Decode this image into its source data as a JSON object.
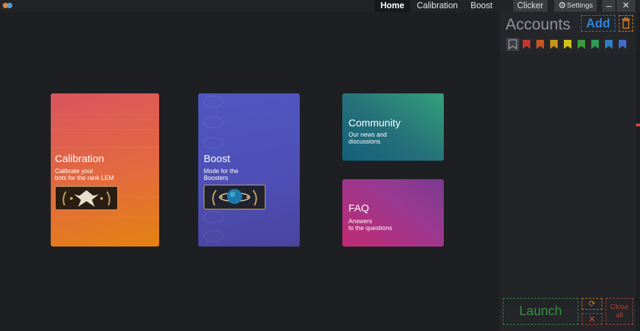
{
  "nav": {
    "tabs": [
      "Home",
      "Calibration",
      "Boost"
    ],
    "active_tab": "Home"
  },
  "toolbar": {
    "clicker_label": "Clicker",
    "settings_label": "Settings",
    "settings_icon": "gear-icon",
    "minimize_icon": "minimize-icon",
    "close_icon": "close-icon"
  },
  "cards": {
    "calibration": {
      "title": "Calibration",
      "subtitle": "Calibrate your\nbots for the rank LEM",
      "badge": "rank-badge-eagle"
    },
    "boost": {
      "title": "Boost",
      "subtitle": "Mode for the\nBoosters",
      "badge": "rank-badge-globe"
    },
    "community": {
      "title": "Community",
      "subtitle": "Our news and\ndiscussions"
    },
    "faq": {
      "title": "FAQ",
      "subtitle": "Answers\nto the questions"
    }
  },
  "accounts": {
    "title": "Accounts",
    "add_label": "Add",
    "delete_icon": "trash-icon",
    "bookmark_colors": [
      "#9b9ea4",
      "#c0392b",
      "#c8541e",
      "#c9921a",
      "#d0c21c",
      "#3f9a3e",
      "#2e9a55",
      "#2f7fc4",
      "#3d6fcf"
    ]
  },
  "actions": {
    "launch_label": "Launch",
    "refresh_icon": "refresh-icon",
    "cancel_icon": "x-icon",
    "close_all_label": "Close\nall"
  },
  "colors": {
    "background": "#1e1f22",
    "panel": "#252629",
    "accent_blue": "#2a84e0",
    "accent_green": "#3b8c44",
    "accent_orange": "#c07b1c",
    "accent_red": "#b5443a"
  }
}
